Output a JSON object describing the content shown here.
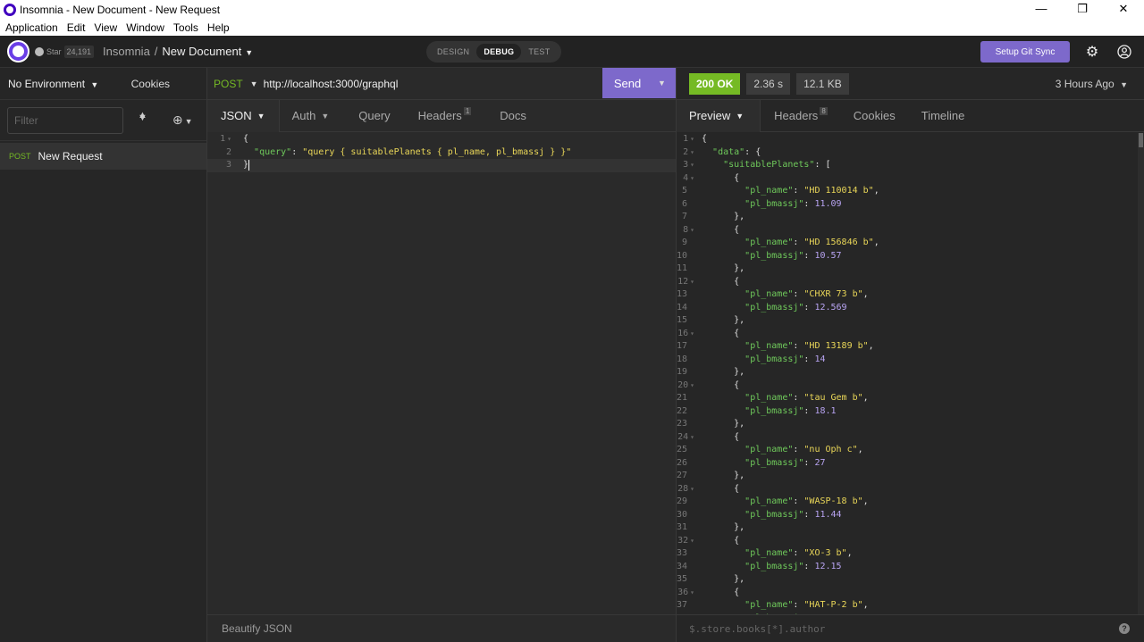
{
  "window": {
    "title": "Insomnia - New Document - New Request",
    "controls": [
      "—",
      "❐",
      "✕"
    ]
  },
  "menu": [
    "Application",
    "Edit",
    "View",
    "Window",
    "Tools",
    "Help"
  ],
  "header": {
    "star_label": "Star",
    "star_count": "24,191",
    "breadcrumb_root": "Insomnia",
    "breadcrumb_sep": "/",
    "document": "New Document",
    "modes": [
      "DESIGN",
      "DEBUG",
      "TEST"
    ],
    "active_mode": "DEBUG",
    "git_sync": "Setup Git Sync"
  },
  "sidebar": {
    "environment": "No Environment",
    "cookies": "Cookies",
    "filter_placeholder": "Filter",
    "requests": [
      {
        "method": "POST",
        "name": "New Request"
      }
    ]
  },
  "request": {
    "method": "POST",
    "url": "http://localhost:3000/graphql",
    "send": "Send",
    "tabs": [
      {
        "label": "JSON",
        "active": true,
        "dropdown": true
      },
      {
        "label": "Auth",
        "dropdown": true
      },
      {
        "label": "Query"
      },
      {
        "label": "Headers",
        "badge": "1"
      },
      {
        "label": "Docs"
      }
    ],
    "body_lines": [
      "{",
      "  \"query\": \"query { suitablePlanets { pl_name, pl_bmassj } }\"",
      "}"
    ],
    "footer": "Beautify JSON"
  },
  "response": {
    "status": "200 OK",
    "time": "2.36 s",
    "size": "12.1 KB",
    "ago": "3 Hours Ago",
    "tabs": [
      {
        "label": "Preview",
        "active": true,
        "dropdown": true
      },
      {
        "label": "Headers",
        "badge": "8"
      },
      {
        "label": "Cookies"
      },
      {
        "label": "Timeline"
      }
    ],
    "filter_placeholder": "$.store.books[*].author",
    "planets": [
      {
        "pl_name": "HD 110014 b",
        "pl_bmassj": "11.09"
      },
      {
        "pl_name": "HD 156846 b",
        "pl_bmassj": "10.57"
      },
      {
        "pl_name": "CHXR 73 b",
        "pl_bmassj": "12.569"
      },
      {
        "pl_name": "HD 13189 b",
        "pl_bmassj": "14"
      },
      {
        "pl_name": "tau Gem b",
        "pl_bmassj": "18.1"
      },
      {
        "pl_name": "nu Oph c",
        "pl_bmassj": "27"
      },
      {
        "pl_name": "WASP-18 b",
        "pl_bmassj": "11.44"
      },
      {
        "pl_name": "XO-3 b",
        "pl_bmassj": "12.15"
      },
      {
        "pl_name": "HAT-P-2 b",
        "pl_bmassj": ""
      }
    ]
  },
  "colors": {
    "accent": "#7d69cb",
    "success": "#75ba24",
    "key": "#6fc95b",
    "string": "#e9d658",
    "number": "#b8a4f2"
  }
}
